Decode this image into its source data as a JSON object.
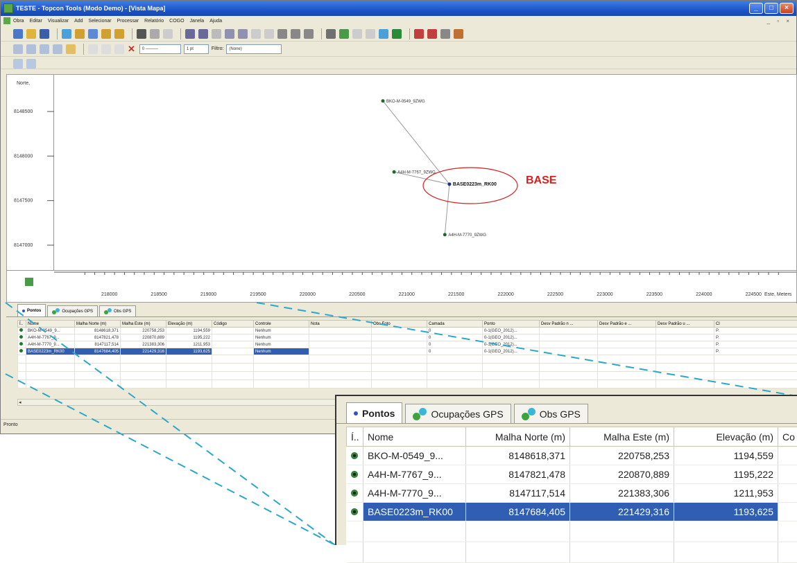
{
  "window": {
    "title": "TESTE - Topcon Tools (Modo Demo) - [Vista Mapa]"
  },
  "menu": [
    "Obra",
    "Editar",
    "Visualizar",
    "Add",
    "Selecionar",
    "Processar",
    "Relatório",
    "COGO",
    "Janela",
    "Ajuda"
  ],
  "toolbar": {
    "line_style": "0 ———",
    "line_width": "1 pt",
    "filter_label": "Filtro:",
    "filter_value": "(None)"
  },
  "plan_view": {
    "y_axis_title": "Norte,",
    "y_ticks": [
      "8148500",
      "8148000",
      "8147500",
      "8147000"
    ],
    "x_axis_title": "Este, Meters",
    "x_ticks": [
      "218000",
      "218500",
      "219000",
      "219500",
      "220000",
      "220500",
      "221000",
      "221500",
      "222000",
      "222500",
      "223000",
      "223500",
      "224000",
      "224500"
    ],
    "points": [
      {
        "label": "BKO-M-0549_9ZWG",
        "este": 220758.253,
        "norte": 8148618.371
      },
      {
        "label": "A4H-M-7767_9ZWG",
        "este": 220870.889,
        "norte": 8147821.478
      },
      {
        "label": "A4H-M-7770_9ZWG",
        "este": 221383.306,
        "norte": 8147117.514
      },
      {
        "label": "BASE0223m_RK00",
        "este": 221429.316,
        "norte": 8147684.405
      }
    ],
    "base_callout": "BASE"
  },
  "panel": {
    "tabs": [
      {
        "label": "Pontos",
        "icon": "point-dot-icon"
      },
      {
        "label": "Ocupações GPS",
        "icon": "gps-occupation-icon"
      },
      {
        "label": "Obs GPS",
        "icon": "gps-obs-icon"
      }
    ],
    "columns": [
      "Í..",
      "Nome",
      "Malha Norte (m)",
      "Malha Este (m)",
      "Elevação (m)",
      "Código",
      "Controle",
      "Nota",
      "Obs Foto",
      "Camada",
      "Ponto",
      "Desv Padrão n ...",
      "Desv Padrão e ...",
      "Desv Padrão u ...",
      "Cl"
    ],
    "rows": [
      {
        "nome": "BKO-M-0549_9...",
        "norte": "8148618,371",
        "este": "220758,253",
        "elev": "1194,559",
        "codigo": "",
        "controle": "Nenhum",
        "nota": "",
        "obs_foto": "",
        "camada": "0",
        "ponto": "0-1(GEO_2012)...",
        "cl": "P."
      },
      {
        "nome": "A4H-M-7767_9...",
        "norte": "8147821,478",
        "este": "220870,889",
        "elev": "1195,222",
        "codigo": "",
        "controle": "Nenhum",
        "nota": "",
        "obs_foto": "",
        "camada": "0",
        "ponto": "0-1(GEO_2012)...",
        "cl": "P."
      },
      {
        "nome": "A4H-M-7770_9...",
        "norte": "8147117,514",
        "este": "221383,306",
        "elev": "1211,953",
        "codigo": "",
        "controle": "Nenhum",
        "nota": "",
        "obs_foto": "",
        "camada": "0",
        "ponto": "0-1(GEO_2012)...",
        "cl": "P."
      },
      {
        "nome": "BASE0223m_RK00",
        "norte": "8147684,405",
        "este": "221429,316",
        "elev": "1193,625",
        "codigo": "",
        "controle": "Nenhum",
        "nota": "",
        "obs_foto": "",
        "camada": "0",
        "ponto": "0-1(GEO_2012)...",
        "cl": "P."
      }
    ],
    "selected_row": 3
  },
  "status": {
    "text": "Pronto"
  },
  "zoom": {
    "columns": [
      "Í..",
      "Nome",
      "Malha Norte (m)",
      "Malha Este (m)",
      "Elevação (m)",
      "Co"
    ]
  },
  "colors": {
    "selection": "#2f5eb3",
    "callout": "#d62020",
    "zoom_lines": "#2aa7c9"
  }
}
